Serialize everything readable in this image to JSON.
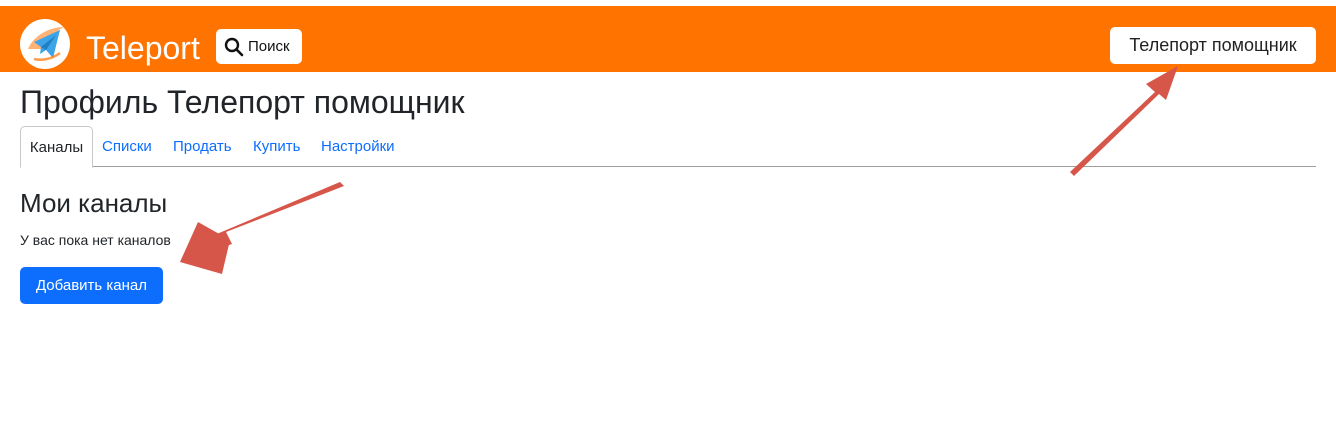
{
  "header": {
    "brand": "Teleport",
    "search_label": "Поиск",
    "user_label": "Телепорт помощник",
    "bar_color": "#ff7300"
  },
  "page": {
    "title": "Профиль Телепорт помощник"
  },
  "tabs": [
    {
      "label": "Каналы",
      "active": true
    },
    {
      "label": "Списки",
      "active": false
    },
    {
      "label": "Продать",
      "active": false
    },
    {
      "label": "Купить",
      "active": false
    },
    {
      "label": "Настройки",
      "active": false
    }
  ],
  "channels": {
    "heading": "Мои каналы",
    "empty_text": "У вас пока нет каналов",
    "add_button": "Добавить канал"
  },
  "colors": {
    "link": "#0d6efd",
    "primary_button": "#0d6efd",
    "annotation_arrow": "#d65649"
  },
  "icons": {
    "logo": "teleport-logo",
    "search": "search-icon",
    "annotation": "arrow-annotation"
  }
}
